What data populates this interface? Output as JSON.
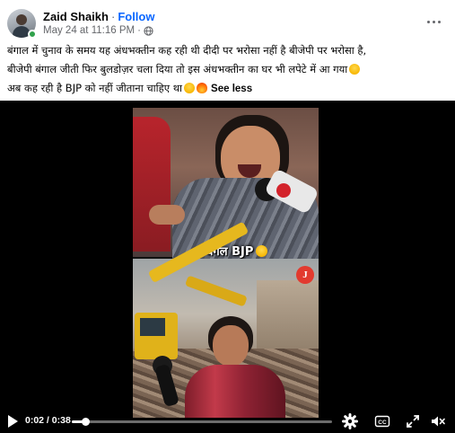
{
  "post": {
    "author": "Zaid Shaikh",
    "separator": "·",
    "follow_label": "Follow",
    "timestamp": "May 24 at 11:16 PM",
    "meta_separator": "·",
    "privacy_icon": "globe-icon",
    "more_icon": "more-options-icon"
  },
  "caption": {
    "line1": "बंगाल में चुनाव के समय यह अंधभक्तीन कह रही थी दीदी पर भरोसा नहीं है बीजेपी पर भरोसा है,",
    "line2": "बीजेपी बंगाल जीती फिर बुलडोज़र चला दिया तो इस अंधभक्तीन का घर भी लपेटे में आ गया",
    "line3": "अब कह रही है BJP को नहीं जीताना चाहिए था",
    "see_less": "See less"
  },
  "video": {
    "overlay_label": "बंगल BJP",
    "logo_letter": "J",
    "current_time": "0:02",
    "time_separator": " / ",
    "duration": "0:38",
    "progress_fraction": 0.053,
    "icons": [
      "play-icon",
      "settings-gear-icon",
      "closed-captions-icon",
      "fullscreen-icon",
      "volume-muted-icon"
    ]
  },
  "colors": {
    "follow": "#0866ff",
    "meta_text": "#65676b",
    "online": "#31a24c",
    "video_bg": "#000000"
  }
}
